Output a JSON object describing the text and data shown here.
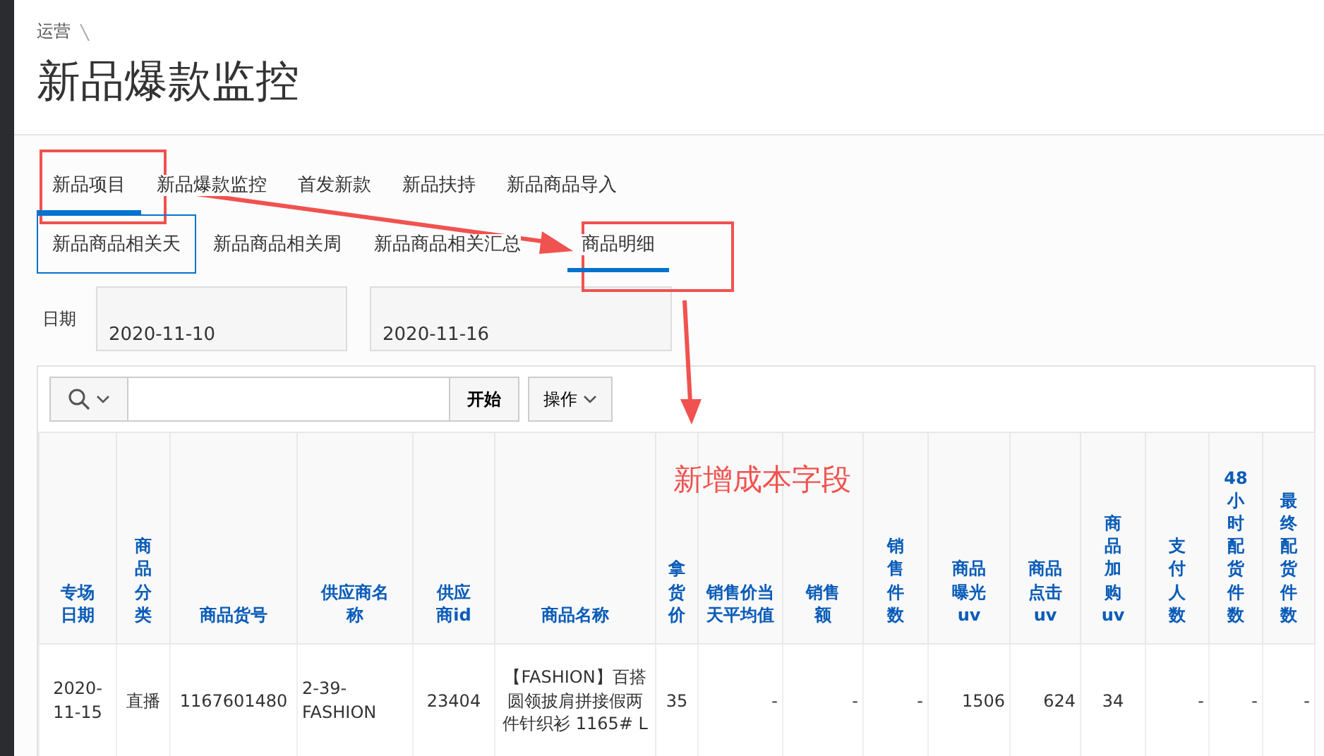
{
  "breadcrumb": [
    "运营"
  ],
  "page_title": "新品爆款监控",
  "tabs": [
    {
      "label": "新品项目",
      "selected": true
    },
    {
      "label": "新品爆款监控",
      "selected": false
    },
    {
      "label": "首发新款",
      "selected": false
    },
    {
      "label": "新品扶持",
      "selected": false
    },
    {
      "label": "新品商品导入",
      "selected": false
    }
  ],
  "subtabs": [
    {
      "label": "新品商品相关天",
      "selected": false,
      "focused": true
    },
    {
      "label": "新品商品相关周",
      "selected": false,
      "focused": false
    },
    {
      "label": "新品商品相关汇总",
      "selected": false,
      "focused": false
    },
    {
      "label": "商品明细",
      "selected": true,
      "focused": false
    }
  ],
  "filters": {
    "label": "日期",
    "fields": [
      {
        "value": "2020-11-10"
      },
      {
        "value": "2020-11-16"
      }
    ]
  },
  "toolbar": {
    "go_button": "开始",
    "actions_button": "操作"
  },
  "table": {
    "columns": [
      "专场日期",
      "商品分类",
      "商品货号",
      "供应商名称",
      "供应商id",
      "商品名称",
      "拿货价",
      "销售价当天平均值",
      "销售额",
      "销售件数",
      "商品曝光uv",
      "商品点击uv",
      "商品加购uv",
      "支付人数",
      "48小时配货件数",
      "最终配货件数"
    ],
    "rows": [
      [
        "2020-11-15",
        "直播",
        "1167601480",
        "2-39-FASHION",
        "23404",
        "【FASHION】百搭圆领披肩拼接假两件针织衫 1165# L",
        "35",
        "-",
        "-",
        "-",
        "1506",
        "624",
        "34",
        "-",
        "-",
        "-"
      ]
    ]
  },
  "annotations": {
    "note": "新增成本字段"
  }
}
